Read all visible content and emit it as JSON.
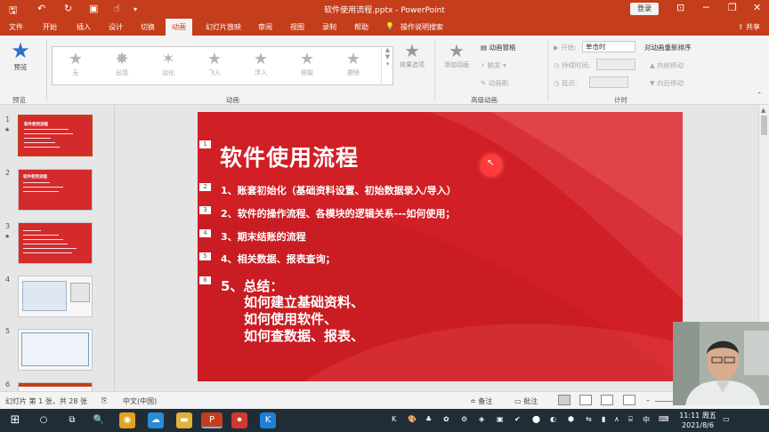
{
  "window": {
    "title": "软件使用流程.pptx  -  PowerPoint",
    "login_label": "登录",
    "share_label": "共享"
  },
  "tabs": [
    "文件",
    "开始",
    "插入",
    "设计",
    "切换",
    "动画",
    "幻灯片放映",
    "审阅",
    "视图",
    "录制",
    "帮助",
    "操作说明搜索"
  ],
  "active_tab": "动画",
  "ribbon": {
    "preview_label": "预览",
    "preview_group": "预览",
    "animation_group": "动画",
    "animations": [
      "无",
      "出现",
      "淡化",
      "飞入",
      "浮入",
      "劈裂",
      "擦除"
    ],
    "effect_options": "效果选项",
    "add_animation": "添加动画",
    "animation_pane": "动画窗格",
    "trigger": "触发",
    "animation_painter": "动画刷",
    "advanced_group": "高级动画",
    "start_label": "开始:",
    "start_value": "单击时",
    "duration_label": "持续时间:",
    "delay_label": "延迟:",
    "reorder_title": "对动画重新排序",
    "move_earlier": "向前移动",
    "move_later": "向后移动",
    "timing_group": "计时"
  },
  "thumbnails": {
    "numbers": [
      "1",
      "2",
      "3",
      "4",
      "5",
      "6"
    ],
    "star": "★",
    "t1": "软件使用流程",
    "t2": "软件使用流程"
  },
  "slide": {
    "markers": [
      "1",
      "2",
      "3",
      "4",
      "5",
      "6"
    ],
    "title": "软件使用流程",
    "items": [
      "1、账套初始化（基础资料设置、初始数据录入/导入）",
      "2、软件的操作流程、各模块的逻辑关系---如何使用；",
      "3、期末结账的流程",
      "4、相关数据、报表查询；"
    ],
    "summary_head": "5、总结：",
    "summary_lines": [
      "如何建立基础资料、",
      "如何使用软件、",
      "如何查数据、报表、"
    ]
  },
  "status": {
    "slide_info": "幻灯片 第 1 张，共 28 张",
    "language": "中文(中国)",
    "notes": "备注",
    "comments": "批注"
  },
  "taskbar": {
    "ime": "中",
    "time": "11:11 周五",
    "date": "2021/8/6"
  }
}
